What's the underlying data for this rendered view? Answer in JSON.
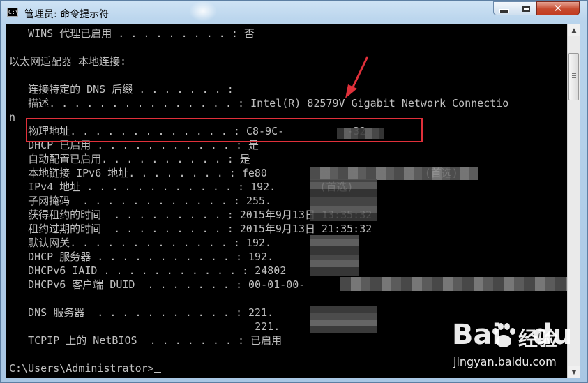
{
  "window": {
    "title": "管理员: 命令提示符",
    "icon": "cmd-icon",
    "icon_text": "C:\\",
    "close_glyph": "✕"
  },
  "console": {
    "lines": [
      "   WINS 代理已启用 . . . . . . . . . : 否",
      "",
      "以太网适配器 本地连接:",
      "",
      "   连接特定的 DNS 后缀 . . . . . . . :",
      "   描述. . . . . . . . . . . . . . . : Intel(R) 82579V Gigabit Network Connectio",
      "n",
      "   物理地址. . . . . . . . . . . . . : C8-9C-          -32",
      "   DHCP 已启用 . . . . . . . . . . . : 是",
      "   自动配置已启用. . . . . . . . . . : 是",
      "   本地链接 IPv6 地址. . . . . . . . : fe80                         (首选)",
      "   IPv4 地址 . . . . . . . . . . . . : 192.       (首选)",
      "   子网掩码  . . . . . . . . . . . . : 255.",
      "   获得租约的时间  . . . . . . . . . : 2015年9月13日 13:35:32",
      "   租约过期的时间  . . . . . . . . . : 2015年9月13日 21:35:32",
      "   默认网关. . . . . . . . . . . . . : 192.",
      "   DHCP 服务器 . . . . . . . . . . . : 192.",
      "   DHCPv6 IAID . . . . . . . . . . . : 24802",
      "   DHCPv6 客户端 DUID  . . . . . . . : 00-01-00-",
      "",
      "   DNS 服务器  . . . . . . . . . . . : 221.",
      "                                       221.",
      "   TCPIP 上的 NetBIOS  . . . . . . . : 已启用",
      "",
      "C:\\Users\\Administrator>"
    ]
  },
  "annotations": {
    "highlight_color": "#e0303a",
    "arrow_color": "#e0303a"
  },
  "watermark": {
    "brand": "Bai",
    "brand2": "du",
    "cn": "经验",
    "url": "jingyan.baidu.com"
  },
  "colors": {
    "console_bg": "#000000",
    "console_text": "#c0c0c0"
  }
}
